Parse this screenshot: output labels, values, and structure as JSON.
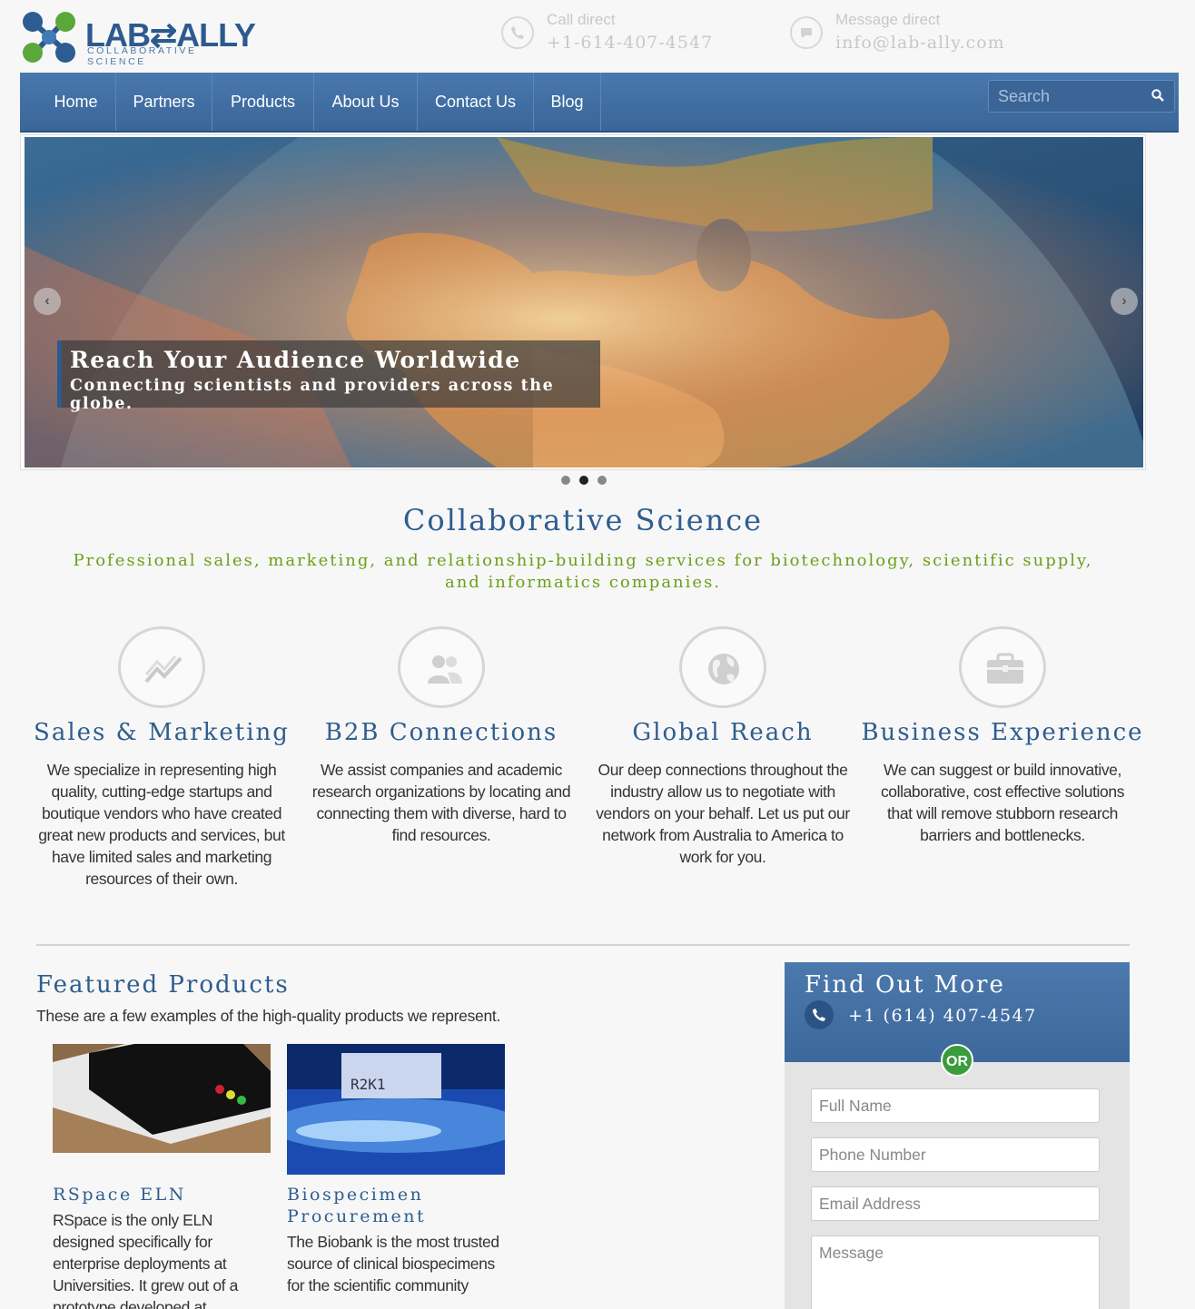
{
  "header": {
    "logo_text": "LAB⇄ALLY",
    "logo_sub": "COLLABORATIVE SCIENCE",
    "call_label": "Call direct",
    "call_value": "+1-614-407-4547",
    "message_label": "Message direct",
    "message_value": "info@lab-ally.com"
  },
  "nav": {
    "items": [
      "Home",
      "Partners",
      "Products",
      "About Us",
      "Contact Us",
      "Blog"
    ],
    "search_placeholder": "Search"
  },
  "hero": {
    "title": "Reach Your Audience Worldwide",
    "subtitle": "Connecting scientists and providers across the globe.",
    "prev_icon": "chevron-left-icon",
    "next_icon": "chevron-right-icon",
    "slides": 3,
    "active_slide": 2
  },
  "intro": {
    "title": "Collaborative Science",
    "subtitle": "Professional sales, marketing, and relationship-building services for biotechnology, scientific supply, and informatics companies."
  },
  "features": [
    {
      "icon": "chart-trend-icon",
      "title": "Sales & Marketing",
      "text": "We specialize in representing high quality, cutting-edge startups and boutique vendors who have created great new products and services, but have limited sales and marketing resources of their own."
    },
    {
      "icon": "users-icon",
      "title": "B2B Connections",
      "text": "We assist companies and academic research organizations by locating and connecting them with diverse, hard to find resources."
    },
    {
      "icon": "globe-icon",
      "title": "Global Reach",
      "text": "Our deep connections throughout the industry allow us to negotiate with vendors on your behalf. Let us put our network from Australia to America to work for you."
    },
    {
      "icon": "briefcase-icon",
      "title": "Business Experience",
      "text": "We can suggest or build innovative, collaborative, cost effective solutions that will remove stubborn research barriers and bottlenecks."
    }
  ],
  "featured": {
    "title": "Featured Products",
    "subtitle": "These are a few examples of the high-quality products we represent.",
    "products": [
      {
        "title": "RSpace ELN",
        "text": "RSpace is the only ELN designed specifically for enterprise deployments at Universities. It grew out of a prototype developed at"
      },
      {
        "title": "Biospecimen Procurement",
        "text": "The Biobank is the most trusted source of clinical biospecimens for the scientific community"
      }
    ]
  },
  "form": {
    "title": "Find Out More",
    "phone": "+1 (614) 407-4547",
    "or_label": "OR",
    "full_name_placeholder": "Full Name",
    "phone_placeholder": "Phone Number",
    "email_placeholder": "Email Address",
    "message_placeholder": "Message"
  },
  "colors": {
    "brand_blue": "#2f5d8e",
    "nav_blue": "#4a78ad",
    "accent_green": "#6aa01a",
    "or_green": "#3a9c3a"
  }
}
